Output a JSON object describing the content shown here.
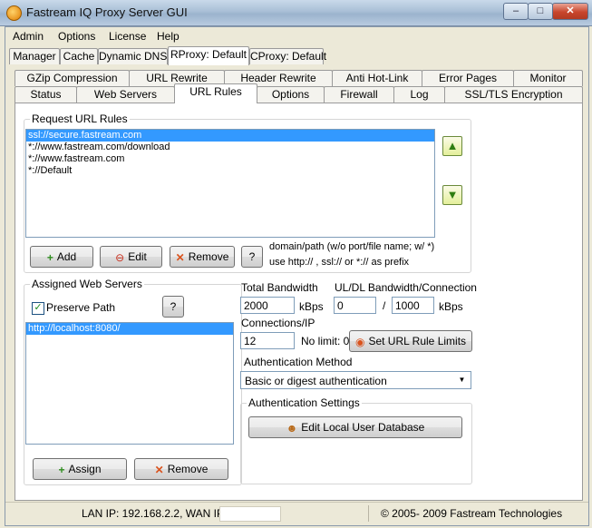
{
  "window": {
    "title": "Fastream IQ Proxy Server GUI",
    "minimize": "–",
    "maximize": "□",
    "close": "✕"
  },
  "menu": [
    "Admin",
    "Options",
    "License",
    "Help"
  ],
  "top_tabs": [
    "Manager",
    "Cache",
    "Dynamic DNS",
    "RProxy: Default",
    "CProxy: Default"
  ],
  "tabs_row1": [
    "GZip Compression",
    "URL Rewrite",
    "Header Rewrite",
    "Anti Hot-Link",
    "Error Pages",
    "Monitor"
  ],
  "tabs_row2": [
    "Status",
    "Web Servers",
    "URL Rules",
    "Options",
    "Firewall",
    "Log",
    "SSL/TLS Encryption"
  ],
  "request_rules": {
    "title": "Request URL Rules",
    "items": [
      "ssl://secure.fastream.com",
      "*://www.fastream.com/download",
      "*://www.fastream.com",
      "*://Default"
    ],
    "add": "Add",
    "edit": "Edit",
    "remove": "Remove",
    "help": "?",
    "hint_line1": "domain/path (w/o port/file name; w/ *)",
    "hint_line2": "use http:// , ssl:// or *:// as prefix"
  },
  "assigned": {
    "title": "Assigned Web Servers",
    "preserve_path": "Preserve Path",
    "help": "?",
    "items": [
      "http://localhost:8080/"
    ],
    "assign": "Assign",
    "remove": "Remove"
  },
  "bandwidth": {
    "total_label": "Total Bandwidth",
    "total_value": "2000",
    "unit1": "kBps",
    "uldl_label": "UL/DL Bandwidth/Connection",
    "ul_value": "0",
    "slash": "/",
    "dl_value": "1000",
    "unit2": "kBps",
    "conn_label": "Connections/IP",
    "conn_value": "12",
    "nolimit": "No limit: 0",
    "set_limits": "Set URL Rule Limits"
  },
  "auth": {
    "method_label": "Authentication Method",
    "method_value": "Basic or digest authentication",
    "settings_title": "Authentication Settings",
    "edit_db": "Edit Local User Database"
  },
  "statusbar": {
    "lan": "LAN IP: 192.168.2.2, WAN IP:",
    "copyright": "© 2005- 2009 Fastream Technologies"
  }
}
